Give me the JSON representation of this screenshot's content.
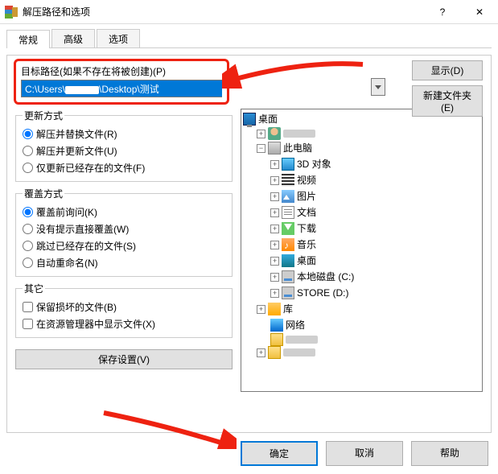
{
  "window": {
    "title": "解压路径和选项"
  },
  "tabs": {
    "general": "常规",
    "advanced": "高级",
    "options": "选项"
  },
  "path": {
    "label": "目标路径(如果不存在将被创建)(P)",
    "value_prefix": "C:\\Users\\",
    "value_suffix": "\\Desktop\\测试"
  },
  "side_buttons": {
    "display": "显示(D)",
    "new_folder": "新建文件夹(E)"
  },
  "update_mode": {
    "legend": "更新方式",
    "opt1": "解压并替换文件(R)",
    "opt2": "解压并更新文件(U)",
    "opt3": "仅更新已经存在的文件(F)"
  },
  "overwrite_mode": {
    "legend": "覆盖方式",
    "opt1": "覆盖前询问(K)",
    "opt2": "没有提示直接覆盖(W)",
    "opt3": "跳过已经存在的文件(S)",
    "opt4": "自动重命名(N)"
  },
  "misc": {
    "legend": "其它",
    "chk1": "保留损坏的文件(B)",
    "chk2": "在资源管理器中显示文件(X)"
  },
  "save_settings": "保存设置(V)",
  "tree": {
    "desktop": "桌面",
    "this_pc": "此电脑",
    "objects3d": "3D 对象",
    "videos": "视频",
    "pictures": "图片",
    "documents": "文档",
    "downloads": "下载",
    "music": "音乐",
    "desk": "桌面",
    "local_disk": "本地磁盘 (C:)",
    "store": "STORE (D:)",
    "libs": "库",
    "network": "网络"
  },
  "footer": {
    "ok": "确定",
    "cancel": "取消",
    "help": "帮助"
  }
}
